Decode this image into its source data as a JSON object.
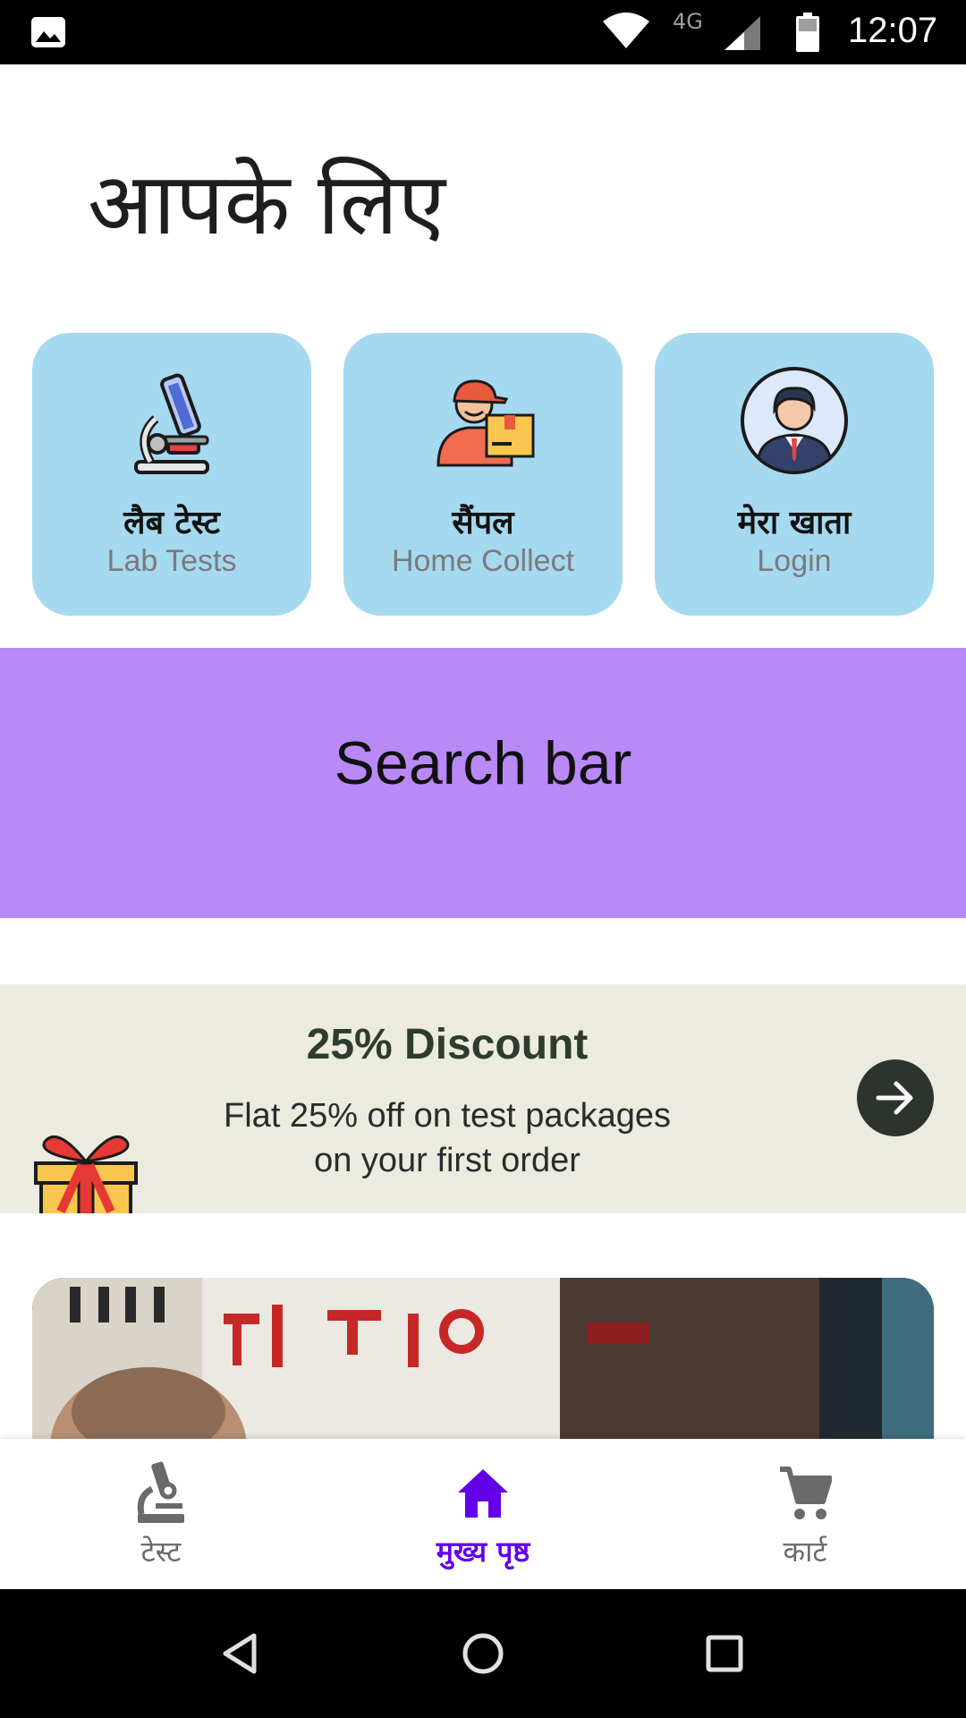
{
  "status_bar": {
    "network": "4G",
    "time": "12:07"
  },
  "page_title": "आपके लिए",
  "tiles": [
    {
      "title_hi": "लैब टेस्ट",
      "title_en": "Lab Tests",
      "icon": "microscope-icon"
    },
    {
      "title_hi": "सैंपल",
      "title_en": "Home Collect",
      "icon": "delivery-person-icon"
    },
    {
      "title_hi": "मेरा खाता",
      "title_en": "Login",
      "icon": "user-avatar-icon"
    }
  ],
  "search": {
    "label": "Search bar"
  },
  "offer": {
    "title": "25% Discount",
    "line1": "Flat 25% off on test packages",
    "line2": "on your first order"
  },
  "bottom_nav": {
    "items": [
      {
        "label": "टेस्ट",
        "icon": "microscope-icon",
        "active": false
      },
      {
        "label": "मुख्य पृष्ठ",
        "icon": "home-icon",
        "active": true
      },
      {
        "label": "कार्ट",
        "icon": "cart-icon",
        "active": false
      }
    ]
  },
  "colors": {
    "tile_bg": "#a5d9f0",
    "search_bg": "#b989f8",
    "offer_bg": "#ebebdf",
    "accent": "#6200ea"
  }
}
